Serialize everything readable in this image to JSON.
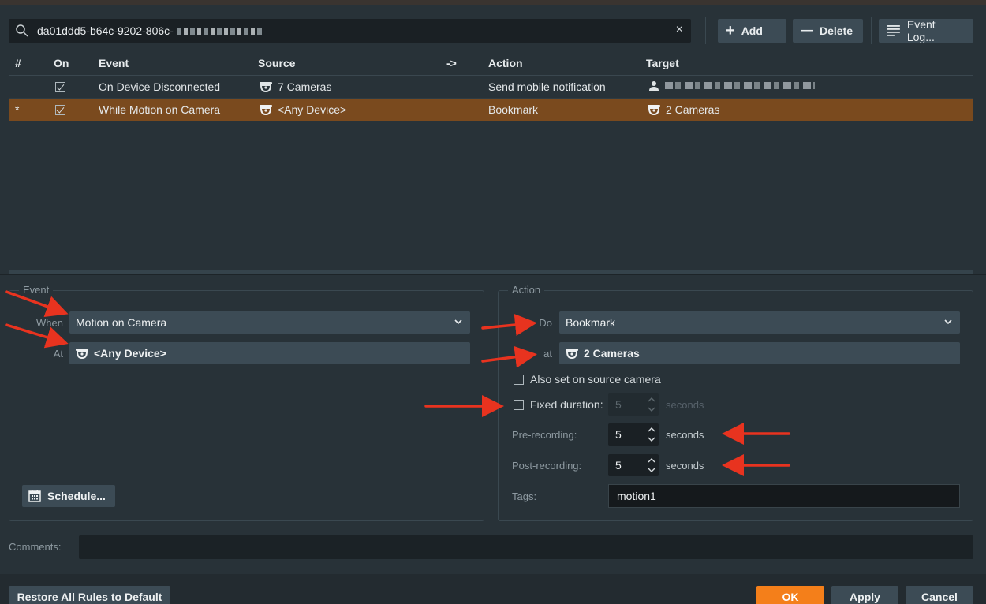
{
  "toolbar": {
    "search_value": "da01ddd5-b64c-9202-806c-",
    "clear_label": "×",
    "add_label": "Add",
    "add_icon": "+",
    "delete_label": "Delete",
    "delete_icon": "—",
    "event_log_label": "Event Log..."
  },
  "table": {
    "columns": [
      "#",
      "On",
      "Event",
      "Source",
      "->",
      "Action",
      "Target"
    ],
    "rows": [
      {
        "num": "",
        "on": true,
        "event": "On Device Disconnected",
        "source": "7 Cameras",
        "action": "Send mobile notification",
        "target": ""
      },
      {
        "num": "*",
        "on": true,
        "event": "While Motion on Camera",
        "source": "<Any Device>",
        "action": "Bookmark",
        "target": "2 Cameras"
      }
    ]
  },
  "event_group": {
    "title": "Event",
    "when_label": "When",
    "when_value": "Motion on Camera",
    "at_label": "At",
    "at_value": "<Any Device>",
    "schedule_label": "Schedule..."
  },
  "action_group": {
    "title": "Action",
    "do_label": "Do",
    "do_value": "Bookmark",
    "at_label": "at",
    "at_value": "2 Cameras",
    "also_set_label": "Also set on source camera",
    "fixed_duration_label": "Fixed duration:",
    "fixed_duration_value": "5",
    "pre_recording_label": "Pre-recording:",
    "pre_recording_value": "5",
    "post_recording_label": "Post-recording:",
    "post_recording_value": "5",
    "seconds_label": "seconds",
    "tags_label": "Tags:",
    "tags_value": "motion1"
  },
  "comments": {
    "label": "Comments:",
    "value": ""
  },
  "footer": {
    "restore_label": "Restore All Rules to Default",
    "ok_label": "OK",
    "apply_label": "Apply",
    "cancel_label": "Cancel"
  },
  "colors": {
    "accent_orange": "#f47f1a",
    "selected_row": "#7a4a1e",
    "annotation_arrow": "#e8331f"
  }
}
